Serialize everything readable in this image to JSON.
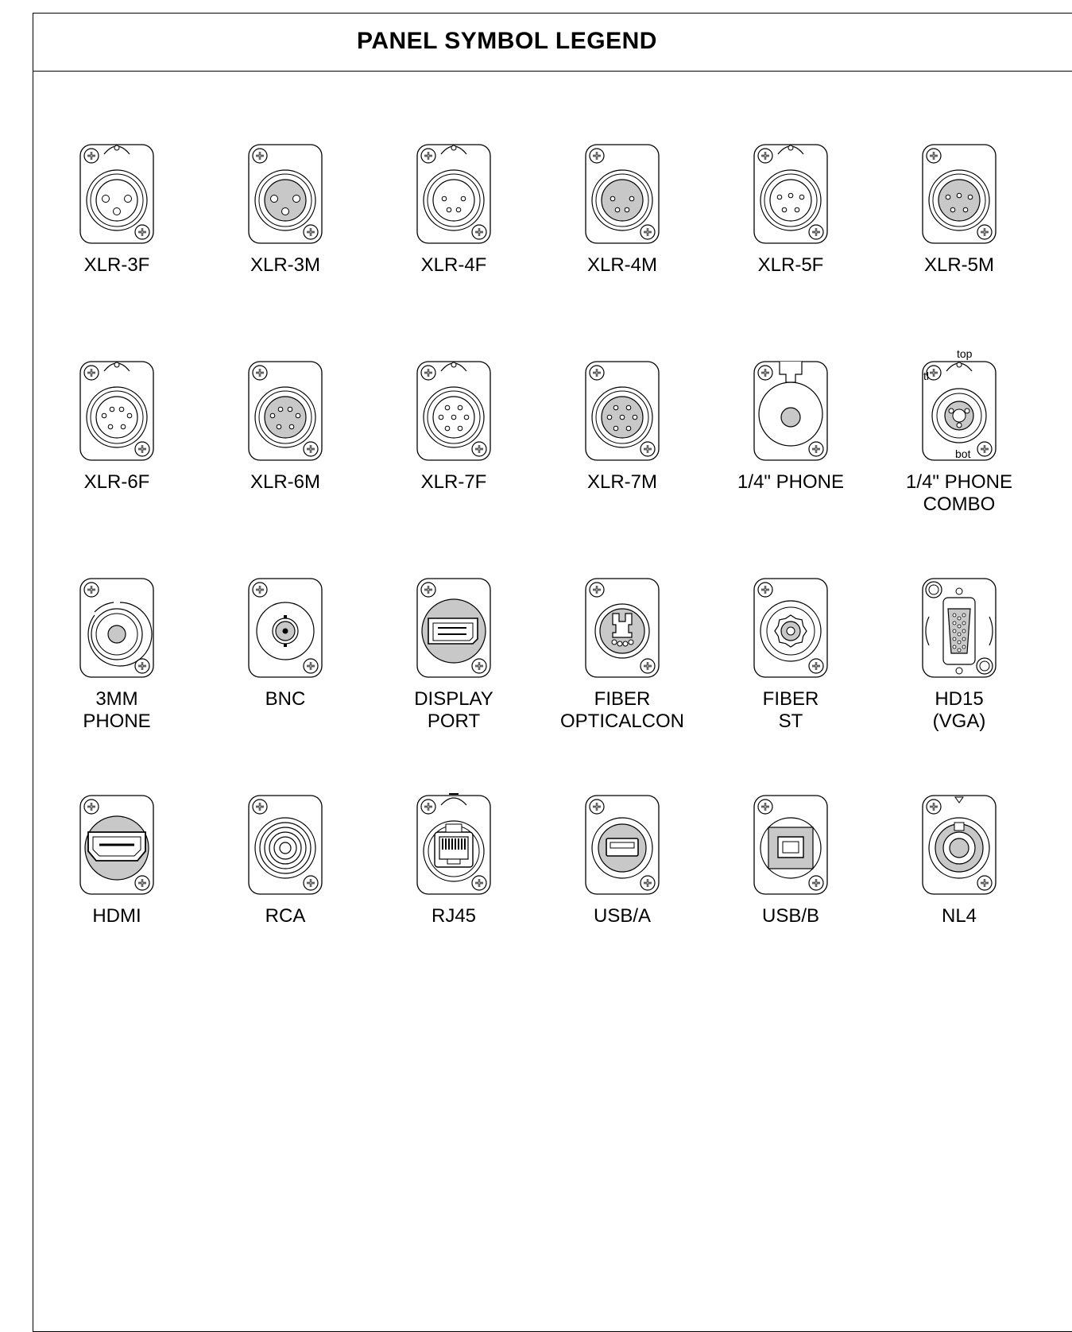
{
  "title": "PANEL SYMBOL LEGEND",
  "rows": [
    [
      {
        "id": "xlr-3f",
        "label": [
          "XLR-3F"
        ],
        "kind": "xlr",
        "pins": 3,
        "gender": "F"
      },
      {
        "id": "xlr-3m",
        "label": [
          "XLR-3M"
        ],
        "kind": "xlr",
        "pins": 3,
        "gender": "M"
      },
      {
        "id": "xlr-4f",
        "label": [
          "XLR-4F"
        ],
        "kind": "xlr",
        "pins": 4,
        "gender": "F"
      },
      {
        "id": "xlr-4m",
        "label": [
          "XLR-4M"
        ],
        "kind": "xlr",
        "pins": 4,
        "gender": "M"
      },
      {
        "id": "xlr-5f",
        "label": [
          "XLR-5F"
        ],
        "kind": "xlr",
        "pins": 5,
        "gender": "F"
      },
      {
        "id": "xlr-5m",
        "label": [
          "XLR-5M"
        ],
        "kind": "xlr",
        "pins": 5,
        "gender": "M"
      }
    ],
    [
      {
        "id": "xlr-6f",
        "label": [
          "XLR-6F"
        ],
        "kind": "xlr",
        "pins": 6,
        "gender": "F"
      },
      {
        "id": "xlr-6m",
        "label": [
          "XLR-6M"
        ],
        "kind": "xlr",
        "pins": 6,
        "gender": "M"
      },
      {
        "id": "xlr-7f",
        "label": [
          "XLR-7F"
        ],
        "kind": "xlr",
        "pins": 7,
        "gender": "F"
      },
      {
        "id": "xlr-7m",
        "label": [
          "XLR-7M"
        ],
        "kind": "xlr",
        "pins": 7,
        "gender": "M"
      },
      {
        "id": "phone-quarter",
        "label": [
          "1/4\" PHONE"
        ],
        "kind": "phone"
      },
      {
        "id": "phone-combo",
        "label": [
          "1/4\" PHONE",
          "COMBO"
        ],
        "kind": "combo"
      }
    ],
    [
      {
        "id": "phone-3mm",
        "label": [
          "3MM",
          "PHONE"
        ],
        "kind": "phone3mm"
      },
      {
        "id": "bnc",
        "label": [
          "BNC"
        ],
        "kind": "bnc"
      },
      {
        "id": "displayport",
        "label": [
          "DISPLAY",
          "PORT"
        ],
        "kind": "displayport"
      },
      {
        "id": "fiber-opticalcon",
        "label": [
          "FIBER",
          "OPTICALCON"
        ],
        "kind": "opticalcon"
      },
      {
        "id": "fiber-st",
        "label": [
          "FIBER",
          "ST"
        ],
        "kind": "fiberst"
      },
      {
        "id": "hd15",
        "label": [
          "HD15",
          "(VGA)"
        ],
        "kind": "vga"
      }
    ],
    [
      {
        "id": "hdmi",
        "label": [
          "HDMI"
        ],
        "kind": "hdmi"
      },
      {
        "id": "rca",
        "label": [
          "RCA"
        ],
        "kind": "rca"
      },
      {
        "id": "rj45",
        "label": [
          "RJ45"
        ],
        "kind": "rj45"
      },
      {
        "id": "usb-a",
        "label": [
          "USB/A"
        ],
        "kind": "usba"
      },
      {
        "id": "usb-b",
        "label": [
          "USB/B"
        ],
        "kind": "usbb"
      },
      {
        "id": "nl4",
        "label": [
          "NL4"
        ],
        "kind": "nl4"
      }
    ]
  ],
  "combo_annotations": {
    "top": "top",
    "left": "tl",
    "bottom": "bot"
  },
  "colors": {
    "line": "#000000",
    "fill_gray": "#c8c8c8",
    "background": "#ffffff"
  }
}
